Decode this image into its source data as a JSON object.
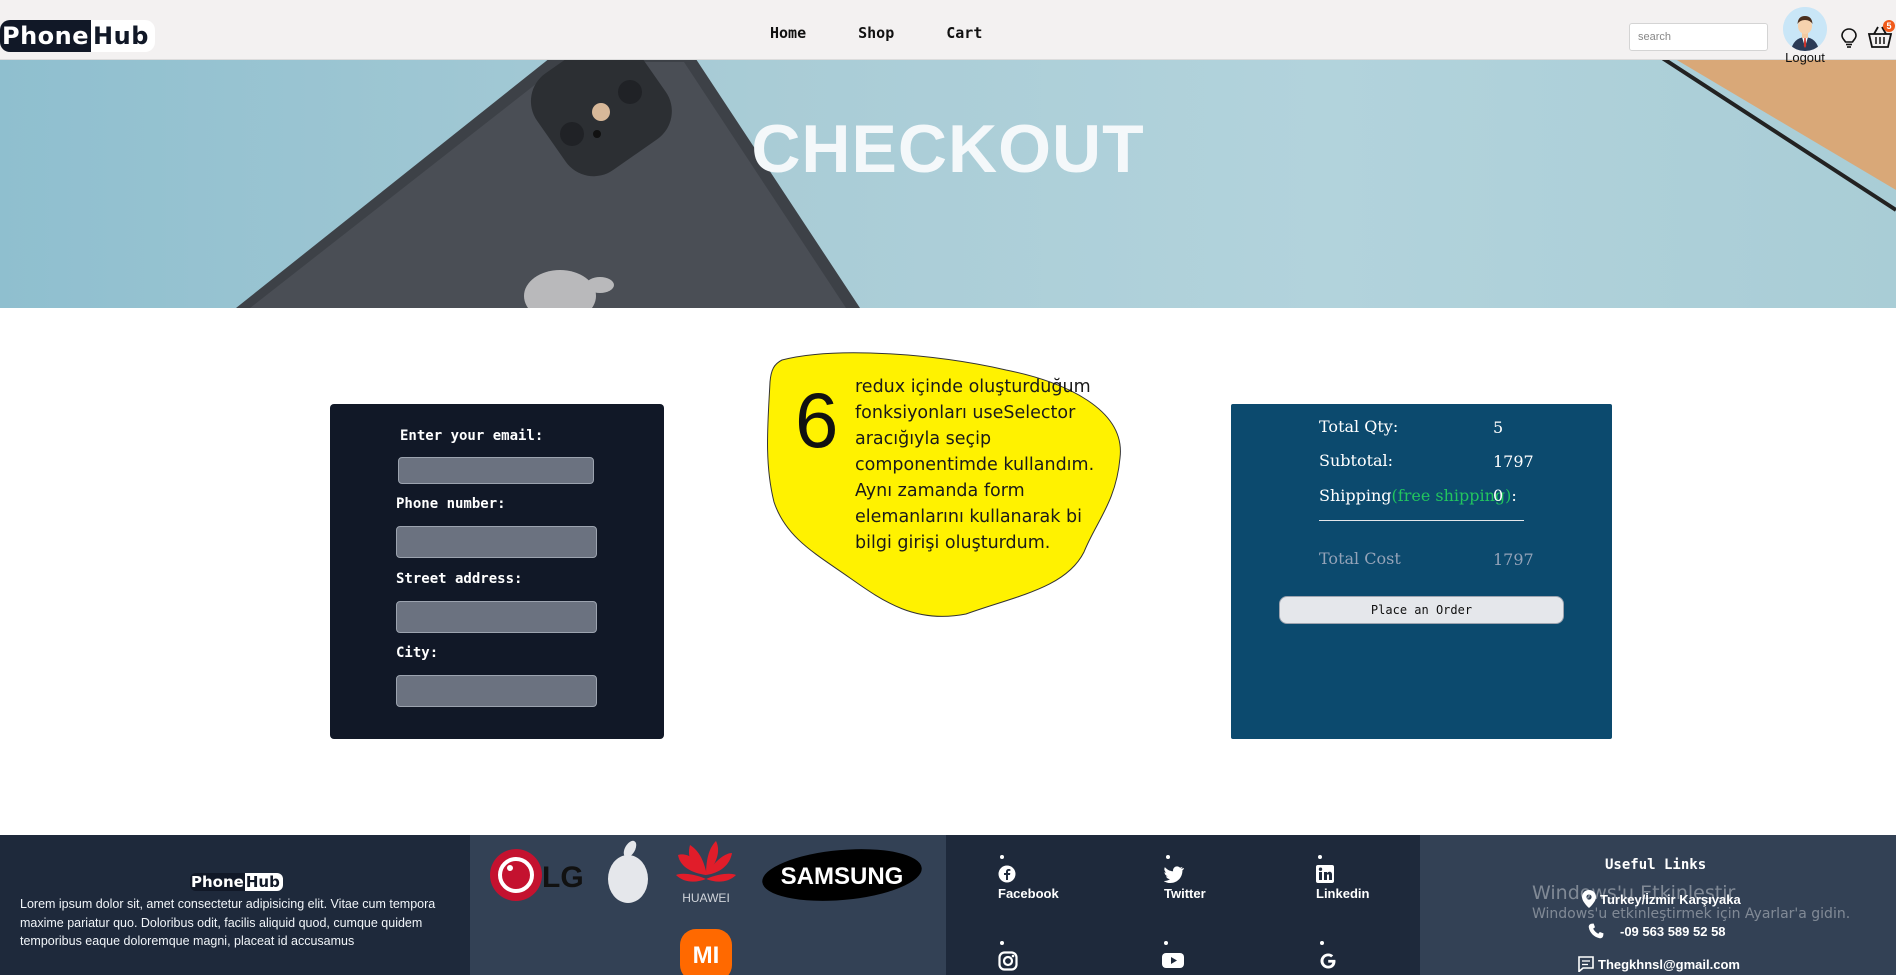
{
  "nav": {
    "logo_part1": "Phone",
    "logo_part2": "Hub",
    "links": [
      "Home",
      "Shop",
      "Cart"
    ],
    "search_placeholder": "search",
    "logout": "Logout",
    "cart_count": "5"
  },
  "hero": {
    "title": "CHECKOUT"
  },
  "form": {
    "email_label": "Enter your email:",
    "phone_label": "Phone number:",
    "street_label": "Street address:",
    "city_label": "City:"
  },
  "note": {
    "number": "6",
    "text": "redux içinde oluşturduğum fonksiyonları useSelector aracığıyla seçip componentimde kullandım. Aynı zamanda form elemanlarını kullanarak bi bilgi girişi oluşturdum."
  },
  "summary": {
    "qty_label": "Total Qty:",
    "qty_value": "5",
    "subtotal_label": "Subtotal:",
    "subtotal_value": "1797",
    "shipping_label": "Shipping",
    "shipping_note": "(free shipping)",
    "shipping_sep": ":",
    "shipping_value": "0",
    "total_label": "Total Cost",
    "total_value": "1797",
    "order_button": "Place an Order"
  },
  "footer": {
    "logo_part1": "Phone",
    "logo_part2": "Hub",
    "about": "Lorem ipsum dolor sit, amet consectetur adipisicing elit. Vitae cum tempora maxime pariatur quo. Doloribus odit, facilis aliquid quod, cumque quidem temporibus eaque doloremque magni, placeat id accusamus",
    "brands": [
      "LG",
      "Apple",
      "HUAWEI",
      "SAMSUNG",
      "MI"
    ],
    "social": [
      "Facebook",
      "Twitter",
      "Linkedin"
    ],
    "useful_title": "Useful Links",
    "address": "Turkey/İzmir Karşıyaka",
    "phone": "-09 563 589 52 58",
    "email": "Thegkhnsl@gmail.com"
  },
  "watermark": {
    "line1": "Windows'u Etkinleştir",
    "line2": "Windows'u etkinleştirmek için Ayarlar'a gidin."
  }
}
